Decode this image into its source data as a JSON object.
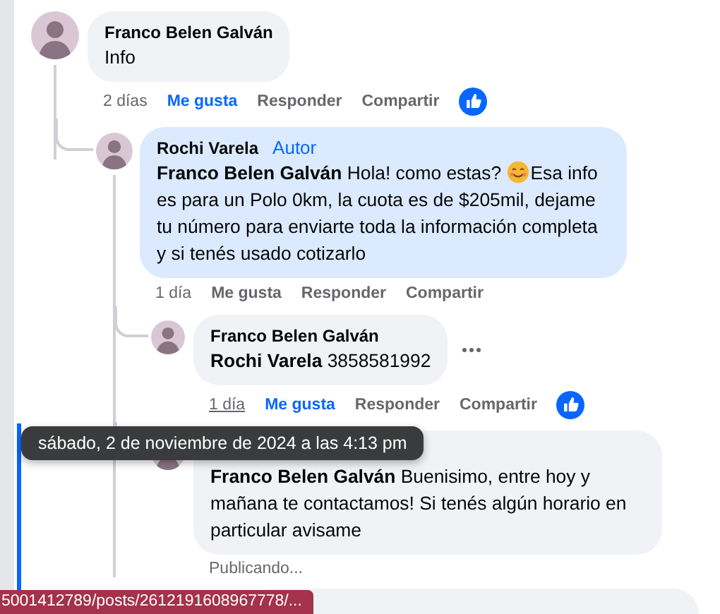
{
  "comments": [
    {
      "author": "Franco Belen Galván",
      "highlighted": false,
      "more_button": false,
      "segments": [
        {
          "kind": "text",
          "text": "Info"
        }
      ],
      "time": "2 días",
      "time_hovered": false,
      "actions": [
        "Me gusta",
        "Responder",
        "Compartir"
      ],
      "liked": true,
      "reacted": true,
      "replies": [
        {
          "author": "Rochi Varela",
          "author_badge": "Autor",
          "highlighted": true,
          "more_button": false,
          "segments": [
            {
              "kind": "text",
              "text": "**Franco Belen Galván** Hola! como estas? "
            },
            {
              "kind": "emoji"
            },
            {
              "kind": "text",
              "text": "Esa info"
            },
            {
              "kind": "break"
            },
            {
              "kind": "text",
              "text": "es para un Polo 0km, la cuota es de $205mil, dejame tu número para enviarte toda la información completa y si tenés usado cotizarlo"
            }
          ],
          "time": "1 día",
          "time_hovered": false,
          "actions": [
            "Me gusta",
            "Responder",
            "Compartir"
          ],
          "liked": false,
          "reacted": false,
          "replies": [
            {
              "author": "Franco Belen Galván",
              "highlighted": false,
              "more_button": true,
              "segments": [
                {
                  "kind": "text",
                  "text": "**Rochi Varela** 3858581992"
                }
              ],
              "time": "1 día",
              "time_hovered": true,
              "actions": [
                "Me gusta",
                "Responder",
                "Compartir"
              ],
              "liked": true,
              "reacted": true
            },
            {
              "highlighted": false,
              "more_button": false,
              "segments": [
                {
                  "kind": "text",
                  "text": "**Franco Belen Galván** Buenisimo, entre hoy y mañana te contactamos! Si tenés algún horario en particular avisame"
                }
              ],
              "status": "Publicando..."
            }
          ]
        }
      ]
    }
  ],
  "tooltip": "sábado, 2 de noviembre de 2024 a las 4:13 pm",
  "status_bar": "5001412789/posts/2612191608967778/..."
}
